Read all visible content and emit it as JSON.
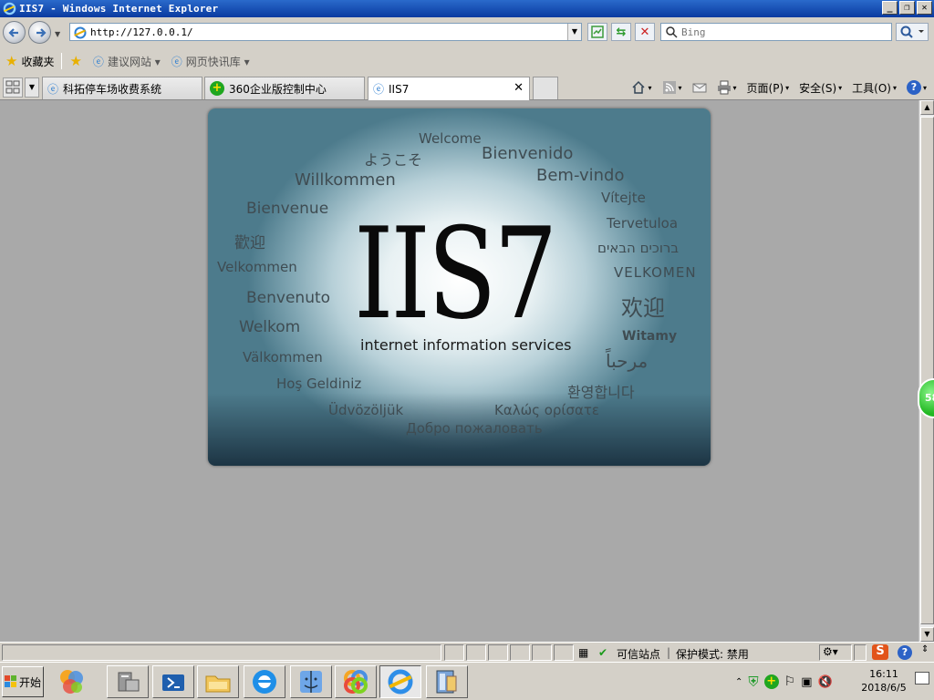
{
  "window": {
    "title": "IIS7 - Windows Internet Explorer",
    "buttons": [
      "_",
      "❐",
      "✕"
    ]
  },
  "address": {
    "url": "http://127.0.0.1/"
  },
  "search": {
    "placeholder": "Bing"
  },
  "favorites": {
    "label": "收藏夹",
    "items": [
      "建议网站 ▾",
      "网页快讯库 ▾"
    ]
  },
  "tabs": [
    {
      "label": "科拓停车场收费系统"
    },
    {
      "label": "360企业版控制中心"
    },
    {
      "label": "IIS7",
      "close": "✕"
    }
  ],
  "commands": {
    "page": "页面(P)",
    "safety": "安全(S)",
    "tools": "工具(O)"
  },
  "iis": {
    "logo": "IIS7",
    "subtitle": "internet information services",
    "words": [
      "Welcome",
      "ようこそ",
      "Bienvenido",
      "Willkommen",
      "Bem-vindo",
      "Vítejte",
      "Bienvenue",
      "Tervetuloa",
      "歡迎",
      "ברוכים הבאים",
      "Velkommen",
      "VELKOMEN",
      "Benvenuto",
      "欢迎",
      "Welkom",
      "Witamy",
      "Välkommen",
      "مرحباً",
      "Hoş Geldiniz",
      "환영합니다",
      "Üdvözöljük",
      "Καλώς ορίσατε",
      "Добро пожаловать"
    ]
  },
  "floating_badge": "58",
  "status": {
    "zone": "可信站点",
    "protected": "保护模式: 禁用"
  },
  "taskbar": {
    "start": "开始"
  },
  "clock": {
    "time": "16:11",
    "date": "2018/6/5"
  }
}
